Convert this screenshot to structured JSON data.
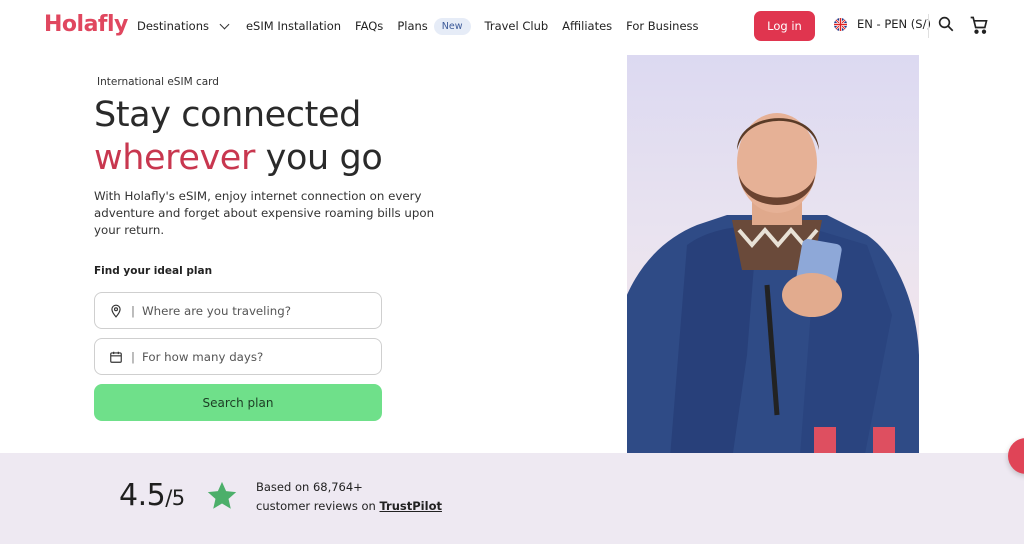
{
  "brand": {
    "logo_text": "Holafly",
    "accent": "#e0475f",
    "cta_green": "#6fe08a"
  },
  "nav": {
    "items": [
      {
        "label": "Destinations",
        "has_dropdown": true
      },
      {
        "label": "eSIM Installation"
      },
      {
        "label": "FAQs"
      },
      {
        "label": "Plans",
        "badge": "New"
      },
      {
        "label": "Travel Club"
      },
      {
        "label": "Affiliates"
      },
      {
        "label": "For Business"
      }
    ],
    "login_label": "Log in",
    "language_label": "EN - PEN (S/)",
    "search_icon": "search-icon",
    "cart_icon": "cart-icon"
  },
  "hero": {
    "eyebrow": "International eSIM card",
    "title_line1": "Stay connected",
    "title_accent": "wherever",
    "title_rest": " you go",
    "lead": "With Holafly's eSIM, enjoy internet connection on every adventure and forget about expensive roaming bills upon your return.",
    "find_label": "Find your ideal plan",
    "destination_placeholder": "Where are you traveling?",
    "days_placeholder": "For how many days?",
    "search_button": "Search plan"
  },
  "rating": {
    "score": "4.5",
    "out_of": "/5",
    "line1": "Based on 68,764+",
    "line2_prefix": "customer reviews on ",
    "source": "TrustPilot"
  }
}
